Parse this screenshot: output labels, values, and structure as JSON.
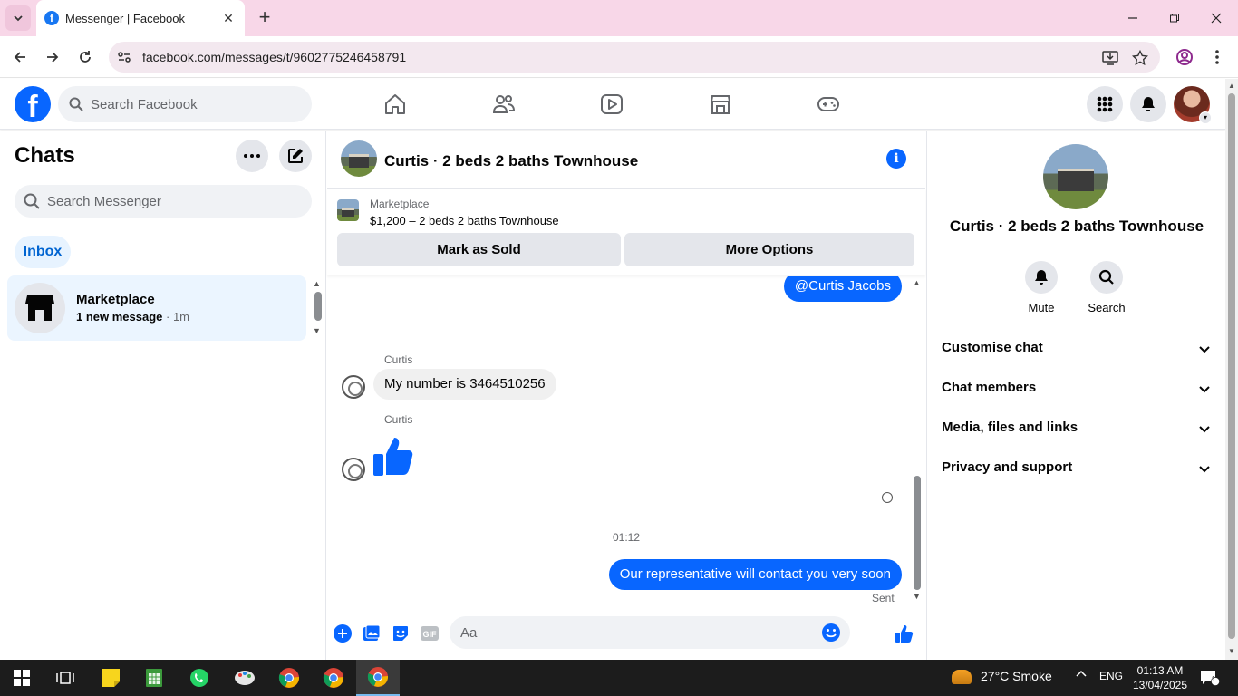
{
  "browser": {
    "tab_title": "Messenger | Facebook",
    "url": "facebook.com/messages/t/9602775246458791",
    "tab_close": "✕",
    "new_tab": "+"
  },
  "fb": {
    "logo": "f",
    "search_placeholder": "Search Facebook",
    "brand_color": "#0866ff"
  },
  "chats": {
    "title": "Chats",
    "search_placeholder": "Search Messenger",
    "filter_inbox": "Inbox",
    "items": [
      {
        "name": "Marketplace",
        "preview": "1 new message",
        "time": " · 1m"
      }
    ]
  },
  "conversation": {
    "title": "Curtis · 2 beds 2 baths Townhouse",
    "marketplace_label": "Marketplace",
    "listing": "$1,200 – 2 beds 2 baths Townhouse",
    "mark_sold": "Mark as Sold",
    "more_options": "More Options",
    "messages": {
      "mention": "@Curtis Jacobs",
      "sender_1": "Curtis",
      "text_1": "My number is 3464510256",
      "sender_2": "Curtis",
      "time": "01:12",
      "outgoing": "Our representative will contact you very soon",
      "status": "Sent"
    },
    "composer_placeholder": "Aa"
  },
  "info_panel": {
    "name": "Curtis · 2 beds 2 baths Townhouse",
    "mute": "Mute",
    "search": "Search",
    "sections": [
      "Customise chat",
      "Chat members",
      "Media, files and links",
      "Privacy and support"
    ]
  },
  "taskbar": {
    "weather": "27°C  Smoke",
    "lang": "ENG",
    "time": "01:13 AM",
    "date": "13/04/2025",
    "notif_count": "1"
  }
}
